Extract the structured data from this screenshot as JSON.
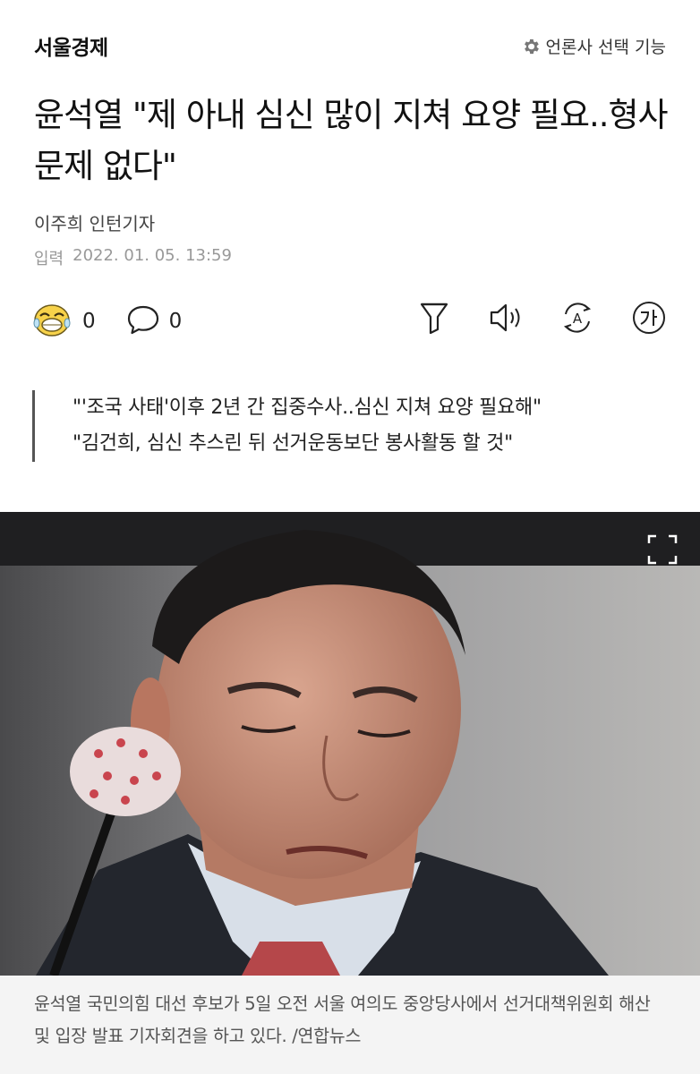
{
  "header": {
    "press_name": "서울경제",
    "press_select_label": "언론사 선택 기능",
    "press_select_icon": "gear-icon"
  },
  "article": {
    "title": "윤석열 \"제 아내 심신 많이 지쳐 요양 필요..형사 문제 없다\"",
    "author": "이주희 인턴기자",
    "date_label": "입력",
    "date_value": "2022. 01. 05. 13:59"
  },
  "actions": {
    "reaction_icon": "emoji-reaction-icon",
    "reaction_count": "0",
    "comment_icon": "comment-bubble-icon",
    "comment_count": "0",
    "tools": [
      "summary-funnel-icon",
      "speaker-icon",
      "translate-icon",
      "font-size-icon"
    ]
  },
  "summary": {
    "lines": [
      "\"'조국 사태'이후 2년 간 집중수사..심신 지쳐 요양 필요해\"",
      "\"김건희, 심신 추스린 뒤 선거운동보단 봉사활동 할 것\""
    ]
  },
  "photo": {
    "expand_icon": "expand-icon",
    "caption": "윤석열 국민의힘 대선 후보가 5일 오전 서울 여의도 중앙당사에서 선거대책위원회 해산 및 입장 발표 기자회견을 하고 있다. /연합뉴스"
  },
  "colors": {
    "text": "#111111",
    "meta": "#999999",
    "caption_bg": "#f4f4f4",
    "quote_bar": "#555555"
  }
}
